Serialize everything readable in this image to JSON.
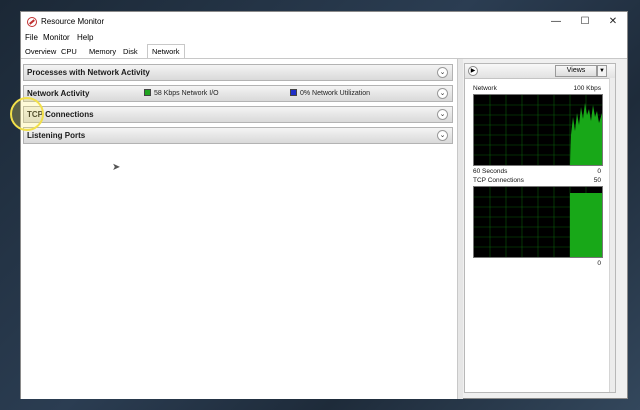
{
  "window": {
    "title": "Resource Monitor"
  },
  "window_controls": {
    "minimize": "—",
    "maximize": "☐",
    "close": "✕"
  },
  "menu": [
    "File",
    "Monitor",
    "Help"
  ],
  "tabs": [
    "Overview",
    "CPU",
    "Memory",
    "Disk",
    "Network"
  ],
  "active_tab": "Network",
  "sections": [
    {
      "title": "Processes with Network Activity"
    },
    {
      "title": "Network Activity",
      "legend": [
        {
          "text": "58 Kbps Network I/O",
          "color": "#1fa31f"
        },
        {
          "text": "0% Network Utilization",
          "color": "#1f2fc8"
        }
      ]
    },
    {
      "title": "TCP Connections"
    },
    {
      "title": "Listening Ports"
    }
  ],
  "right_panel": {
    "views_label": "Views",
    "graphs": [
      {
        "name": "Network",
        "max_label": "100 Kbps",
        "left_bottom": "60 Seconds",
        "right_bottom": "0",
        "fill_color": "#18a818"
      },
      {
        "name": "TCP Connections",
        "max_label": "50",
        "left_bottom": "",
        "right_bottom": "0",
        "fill_color": "#18a818"
      }
    ]
  }
}
